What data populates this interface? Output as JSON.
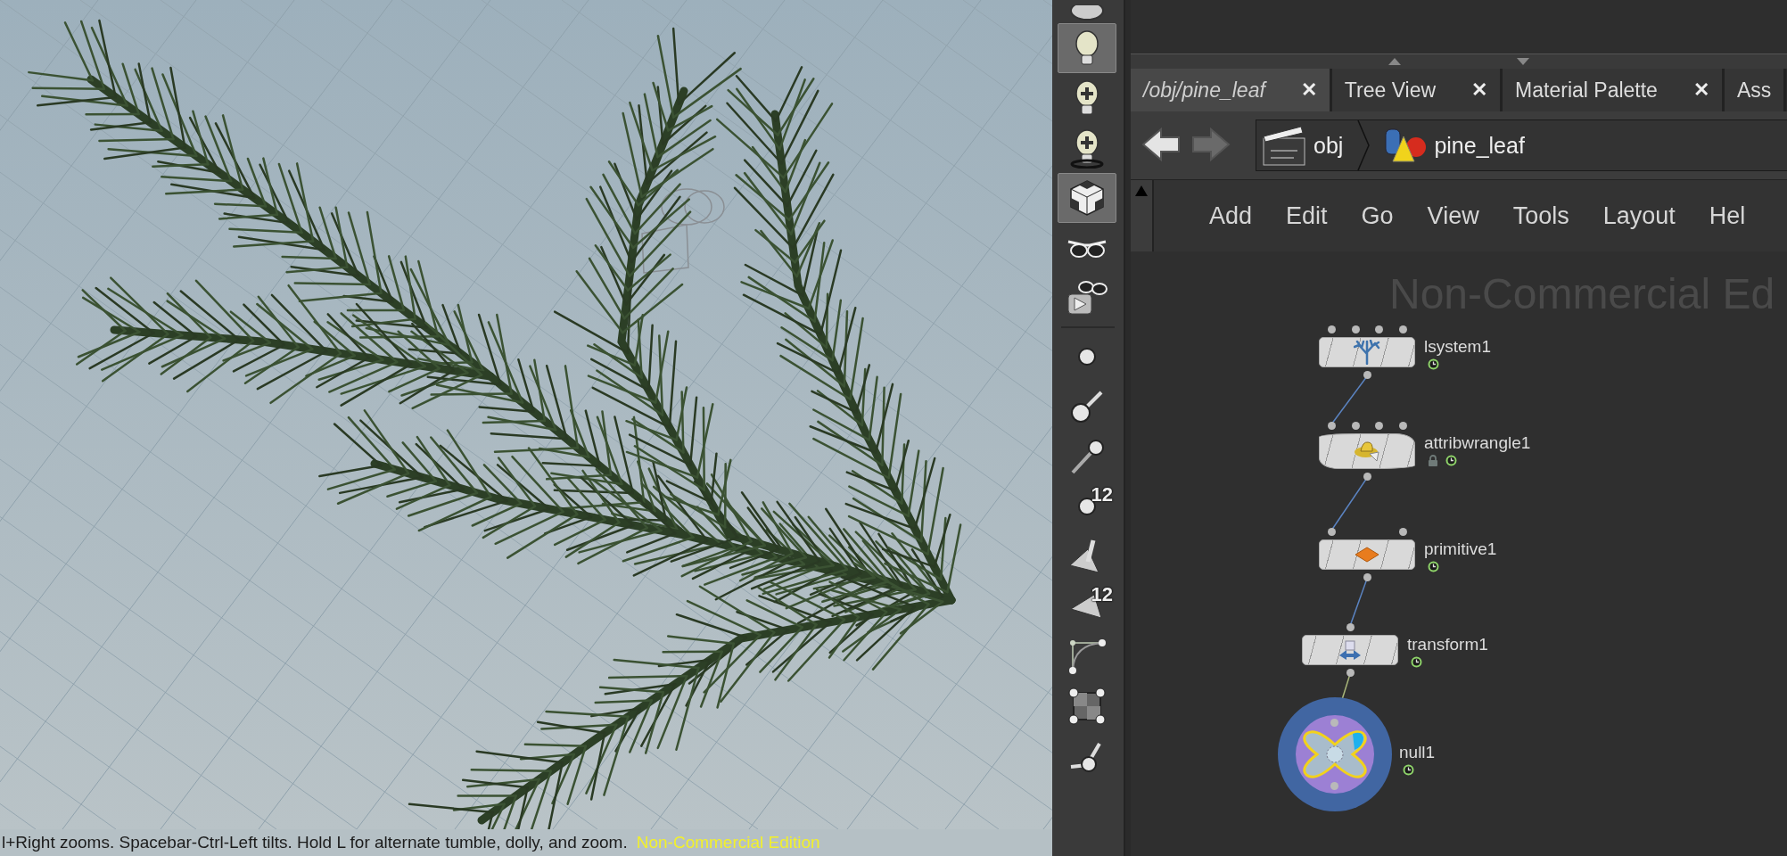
{
  "viewport": {
    "help_text": "l+Right zooms. Spacebar-Ctrl-Left tilts. Hold L for alternate tumble, dolly, and zoom.",
    "edition_text": "Non-Commercial Edition"
  },
  "toolbar": [
    {
      "kind": "camera",
      "selected": false
    },
    {
      "kind": "light",
      "selected": true
    },
    {
      "kind": "light-add",
      "selected": false
    },
    {
      "kind": "spot-add",
      "selected": false
    },
    {
      "kind": "cube",
      "selected": true
    },
    {
      "kind": "glasses",
      "selected": false
    },
    {
      "kind": "glasses-play",
      "selected": false
    },
    {
      "kind": "divider"
    },
    {
      "kind": "point",
      "selected": false
    },
    {
      "kind": "point-stick",
      "selected": false
    },
    {
      "kind": "point-arrow",
      "selected": false
    },
    {
      "kind": "point-number",
      "selected": false,
      "badge": "12"
    },
    {
      "kind": "prim-stick",
      "selected": false
    },
    {
      "kind": "prim-number",
      "selected": false,
      "badge": "12"
    },
    {
      "kind": "curve",
      "selected": false
    },
    {
      "kind": "square-points",
      "selected": false
    },
    {
      "kind": "edge",
      "selected": false
    }
  ],
  "tabs": [
    {
      "label": "/obj/pine_leaf",
      "selected": true,
      "close": "✕"
    },
    {
      "label": "Tree View",
      "selected": false,
      "close": "✕"
    },
    {
      "label": "Material Palette",
      "selected": false,
      "close": "✕"
    },
    {
      "label": "Ass",
      "selected": false
    }
  ],
  "nav": {
    "back_disabled": false,
    "forward_disabled": true
  },
  "breadcrumb": [
    {
      "label": "obj",
      "kind": "network"
    },
    {
      "label": "pine_leaf",
      "kind": "geometry"
    }
  ],
  "menu": [
    "Add",
    "Edit",
    "Go",
    "View",
    "Tools",
    "Layout",
    "Hel"
  ],
  "graph": {
    "watermark": "Non-Commercial Ed",
    "nodes": [
      {
        "name": "lsystem1",
        "kind": "lsystem",
        "locked": false
      },
      {
        "name": "attribwrangle1",
        "kind": "wrangle",
        "locked": true
      },
      {
        "name": "primitive1",
        "kind": "primitive",
        "locked": false
      },
      {
        "name": "transform1",
        "kind": "transform",
        "locked": false
      },
      {
        "name": "null1",
        "kind": "null",
        "locked": false
      }
    ]
  }
}
